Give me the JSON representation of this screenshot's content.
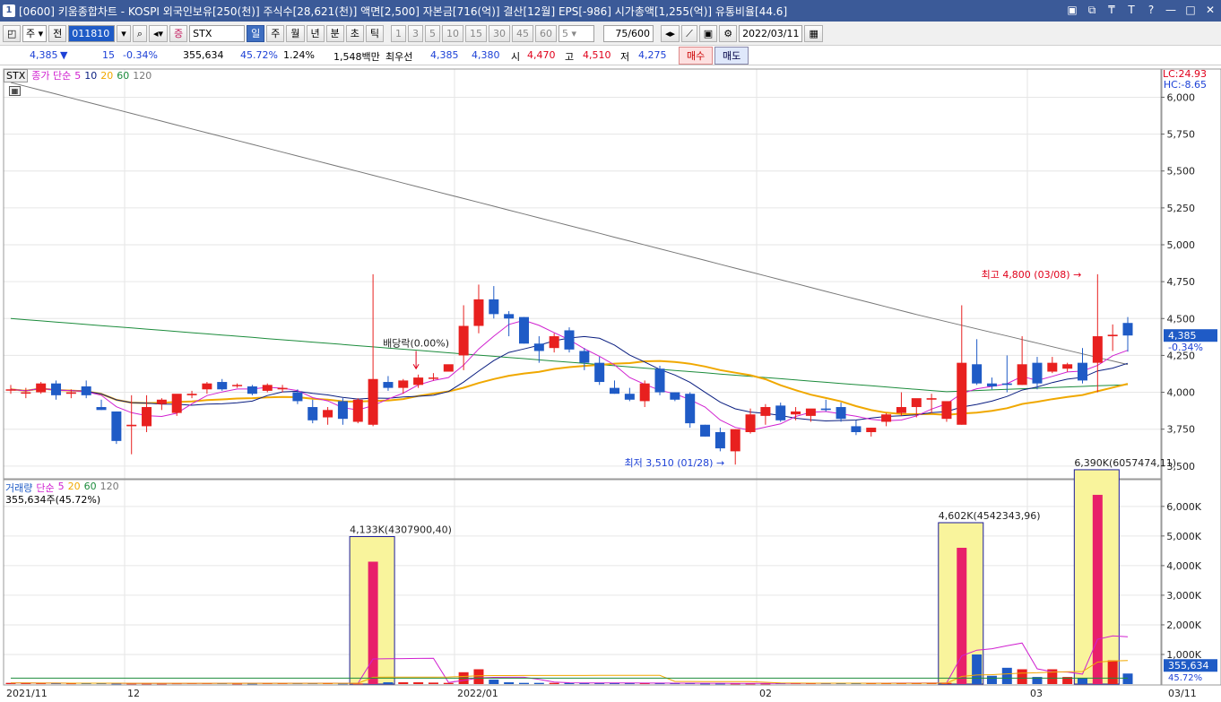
{
  "titlebar": {
    "window_no": "1",
    "text": "[0600] 키움종합차트 - KOSPI 외국인보유[250(천)] 주식수[28,621(천)] 액면[2,500] 자본금[716(억)] 결산[12월] EPS[-986] 시가총액[1,255(억)] 유통비율[44.6]",
    "controls": [
      "▣",
      "⧉",
      "₸",
      "T",
      "?",
      "—",
      "□",
      "✕"
    ]
  },
  "toolbar": {
    "type_label": "주",
    "all_label": "전",
    "stock_code": "011810",
    "stock_name": "STX",
    "period_tabs": [
      "일",
      "주",
      "월",
      "년",
      "분",
      "초",
      "틱"
    ],
    "selected_period": "일",
    "interval_buttons": [
      "1",
      "3",
      "5",
      "10",
      "15",
      "30",
      "45",
      "60"
    ],
    "interval_select": "5",
    "count": "75",
    "count_max": "/600",
    "date": "2022/03/11"
  },
  "quote": {
    "price": "4,385",
    "change": "15",
    "change_pct": "-0.34%",
    "volume": "355,634",
    "vol_ratio": "45.72%",
    "turnover": "1.24%",
    "amount": "1,548백만",
    "best_bid_label": "최우선",
    "best_ask": "4,385",
    "best_bid": "4,380",
    "open_label": "시",
    "open": "4,470",
    "high_label": "고",
    "high": "4,510",
    "low_label": "저",
    "low": "4,275",
    "buy_label": "매수",
    "sell_label": "매도"
  },
  "price_panel": {
    "legend_stx": "STX",
    "legend_title": "종가 단순",
    "ma_labels": [
      "5",
      "10",
      "20",
      "60",
      "120"
    ],
    "lc": "LC:24.93",
    "hc": "HC:-8.65",
    "current_price": "4,385",
    "current_change": "-0.34%",
    "high_annotation": "최고 4,800 (03/08)",
    "low_annotation": "최저 3,510 (01/28)",
    "dividend_annotation": "배당락(0.00%)"
  },
  "volume_panel": {
    "legend_title": "거래량",
    "legend_sub": "단순",
    "ma_labels": [
      "5",
      "20",
      "60",
      "120"
    ],
    "current_volume_text": "355,634주(45.72%)",
    "current_volume": "355,634",
    "current_ratio": "45.72%",
    "annotations": [
      "4,133K(4307900,40)",
      "4,602K(4542343,96)",
      "6,390K(6057474,11)"
    ]
  },
  "x_labels": [
    "2021/11",
    "12",
    "2022/01",
    "02",
    "03",
    "03/11"
  ],
  "colors": {
    "up": "#e8201f",
    "down": "#1f5bc6",
    "ma5": "#d020d0",
    "ma10": "#0a1e80",
    "ma20": "#f0a800",
    "ma60": "#1c8c3c",
    "ma120": "#777777",
    "vol_hl": "#f9f49c",
    "vol_up": "#e8206a"
  },
  "chart_data": {
    "type": "candlestick",
    "price_axis_ticks": [
      6000,
      5750,
      5500,
      5250,
      5000,
      4750,
      4500,
      4250,
      4000,
      3750,
      3500
    ],
    "volume_axis_ticks": [
      "6,000K",
      "5,000K",
      "4,000K",
      "3,000K",
      "2,000K",
      "1,000K"
    ],
    "volume_ylim": [
      0,
      6600
    ],
    "price_ylim": [
      3420,
      6100
    ],
    "candles": [
      {
        "o": 4020,
        "h": 4050,
        "l": 3990,
        "c": 4020
      },
      {
        "o": 4000,
        "h": 4030,
        "l": 3960,
        "c": 4000
      },
      {
        "o": 4000,
        "h": 4070,
        "l": 3990,
        "c": 4060
      },
      {
        "o": 4060,
        "h": 4080,
        "l": 3950,
        "c": 3980
      },
      {
        "o": 3990,
        "h": 4020,
        "l": 3960,
        "c": 4000
      },
      {
        "o": 4040,
        "h": 4080,
        "l": 3960,
        "c": 3980
      },
      {
        "o": 3900,
        "h": 3950,
        "l": 3880,
        "c": 3880
      },
      {
        "o": 3870,
        "h": 3870,
        "l": 3650,
        "c": 3670
      },
      {
        "o": 3770,
        "h": 3980,
        "l": 3580,
        "c": 3780
      },
      {
        "o": 3770,
        "h": 3980,
        "l": 3730,
        "c": 3900
      },
      {
        "o": 3920,
        "h": 3960,
        "l": 3880,
        "c": 3950
      },
      {
        "o": 3860,
        "h": 3960,
        "l": 3840,
        "c": 3990
      },
      {
        "o": 3980,
        "h": 4010,
        "l": 3960,
        "c": 3990
      },
      {
        "o": 4020,
        "h": 4070,
        "l": 3990,
        "c": 4060
      },
      {
        "o": 4070,
        "h": 4090,
        "l": 4010,
        "c": 4020
      },
      {
        "o": 4050,
        "h": 4060,
        "l": 4030,
        "c": 4050
      },
      {
        "o": 4040,
        "h": 4050,
        "l": 3980,
        "c": 3990
      },
      {
        "o": 4010,
        "h": 4060,
        "l": 4000,
        "c": 4050
      },
      {
        "o": 4020,
        "h": 4050,
        "l": 4000,
        "c": 4030
      },
      {
        "o": 4000,
        "h": 4020,
        "l": 3920,
        "c": 3940
      },
      {
        "o": 3900,
        "h": 3950,
        "l": 3790,
        "c": 3810
      },
      {
        "o": 3830,
        "h": 3900,
        "l": 3780,
        "c": 3880
      },
      {
        "o": 3940,
        "h": 3960,
        "l": 3780,
        "c": 3820
      },
      {
        "o": 3800,
        "h": 3960,
        "l": 3790,
        "c": 3950
      },
      {
        "o": 3780,
        "h": 4800,
        "l": 3770,
        "c": 4090
      },
      {
        "o": 4070,
        "h": 4110,
        "l": 4010,
        "c": 4030
      },
      {
        "o": 4030,
        "h": 4090,
        "l": 3990,
        "c": 4080
      },
      {
        "o": 4050,
        "h": 4120,
        "l": 4030,
        "c": 4100
      },
      {
        "o": 4100,
        "h": 4130,
        "l": 4080,
        "c": 4100
      },
      {
        "o": 4140,
        "h": 4180,
        "l": 4140,
        "c": 4190
      },
      {
        "o": 4250,
        "h": 4590,
        "l": 4150,
        "c": 4450
      },
      {
        "o": 4450,
        "h": 4730,
        "l": 4400,
        "c": 4630
      },
      {
        "o": 4630,
        "h": 4720,
        "l": 4500,
        "c": 4530
      },
      {
        "o": 4530,
        "h": 4550,
        "l": 4380,
        "c": 4500
      },
      {
        "o": 4510,
        "h": 4510,
        "l": 4330,
        "c": 4330
      },
      {
        "o": 4330,
        "h": 4380,
        "l": 4200,
        "c": 4280
      },
      {
        "o": 4300,
        "h": 4400,
        "l": 4270,
        "c": 4380
      },
      {
        "o": 4420,
        "h": 4440,
        "l": 4270,
        "c": 4290
      },
      {
        "o": 4280,
        "h": 4300,
        "l": 4150,
        "c": 4200
      },
      {
        "o": 4200,
        "h": 4240,
        "l": 4050,
        "c": 4070
      },
      {
        "o": 4030,
        "h": 4080,
        "l": 3990,
        "c": 3990
      },
      {
        "o": 3990,
        "h": 4030,
        "l": 3940,
        "c": 3950
      },
      {
        "o": 3940,
        "h": 4080,
        "l": 3900,
        "c": 4060
      },
      {
        "o": 4160,
        "h": 4180,
        "l": 3980,
        "c": 4000
      },
      {
        "o": 4000,
        "h": 4000,
        "l": 3940,
        "c": 3950
      },
      {
        "o": 3990,
        "h": 4000,
        "l": 3760,
        "c": 3790
      },
      {
        "o": 3780,
        "h": 3780,
        "l": 3700,
        "c": 3700
      },
      {
        "o": 3730,
        "h": 3760,
        "l": 3600,
        "c": 3620
      },
      {
        "o": 3600,
        "h": 3750,
        "l": 3510,
        "c": 3750
      },
      {
        "o": 3730,
        "h": 3890,
        "l": 3720,
        "c": 3850
      },
      {
        "o": 3840,
        "h": 3920,
        "l": 3780,
        "c": 3900
      },
      {
        "o": 3910,
        "h": 3930,
        "l": 3800,
        "c": 3810
      },
      {
        "o": 3850,
        "h": 3900,
        "l": 3810,
        "c": 3870
      },
      {
        "o": 3840,
        "h": 3870,
        "l": 3800,
        "c": 3890
      },
      {
        "o": 3890,
        "h": 3950,
        "l": 3870,
        "c": 3880
      },
      {
        "o": 3900,
        "h": 3930,
        "l": 3800,
        "c": 3820
      },
      {
        "o": 3770,
        "h": 3810,
        "l": 3710,
        "c": 3730
      },
      {
        "o": 3730,
        "h": 3760,
        "l": 3700,
        "c": 3760
      },
      {
        "o": 3800,
        "h": 3860,
        "l": 3770,
        "c": 3850
      },
      {
        "o": 3860,
        "h": 4000,
        "l": 3840,
        "c": 3900
      },
      {
        "o": 3900,
        "h": 3950,
        "l": 3830,
        "c": 3960
      },
      {
        "o": 3950,
        "h": 3990,
        "l": 3860,
        "c": 3960
      },
      {
        "o": 3820,
        "h": 3880,
        "l": 3800,
        "c": 3940
      },
      {
        "o": 3780,
        "h": 4590,
        "l": 3780,
        "c": 4200
      },
      {
        "o": 4190,
        "h": 4360,
        "l": 4050,
        "c": 4060
      },
      {
        "o": 4060,
        "h": 4100,
        "l": 4020,
        "c": 4040
      },
      {
        "o": 4060,
        "h": 4250,
        "l": 4000,
        "c": 4050
      },
      {
        "o": 4050,
        "h": 4380,
        "l": 4050,
        "c": 4190
      },
      {
        "o": 4200,
        "h": 4240,
        "l": 4020,
        "c": 4060
      },
      {
        "o": 4140,
        "h": 4240,
        "l": 4130,
        "c": 4200
      },
      {
        "o": 4160,
        "h": 4200,
        "l": 4140,
        "c": 4190
      },
      {
        "o": 4200,
        "h": 4300,
        "l": 4060,
        "c": 4080
      },
      {
        "o": 4200,
        "h": 4800,
        "l": 4000,
        "c": 4380
      },
      {
        "o": 4380,
        "h": 4460,
        "l": 4280,
        "c": 4390
      },
      {
        "o": 4470,
        "h": 4510,
        "l": 4275,
        "c": 4385
      }
    ],
    "volumes": [
      40,
      30,
      30,
      30,
      28,
      30,
      30,
      20,
      20,
      20,
      20,
      28,
      30,
      30,
      30,
      20,
      20,
      30,
      30,
      30,
      30,
      30,
      20,
      20,
      4133,
      60,
      60,
      60,
      50,
      40,
      400,
      500,
      150,
      60,
      40,
      40,
      40,
      40,
      40,
      40,
      30,
      30,
      30,
      30,
      30,
      30,
      20,
      20,
      20,
      20,
      20,
      30,
      30,
      30,
      30,
      30,
      30,
      30,
      30,
      40,
      40,
      40,
      40,
      4602,
      1000,
      280,
      550,
      500,
      240,
      500,
      240,
      200,
      6390,
      800,
      356
    ]
  }
}
